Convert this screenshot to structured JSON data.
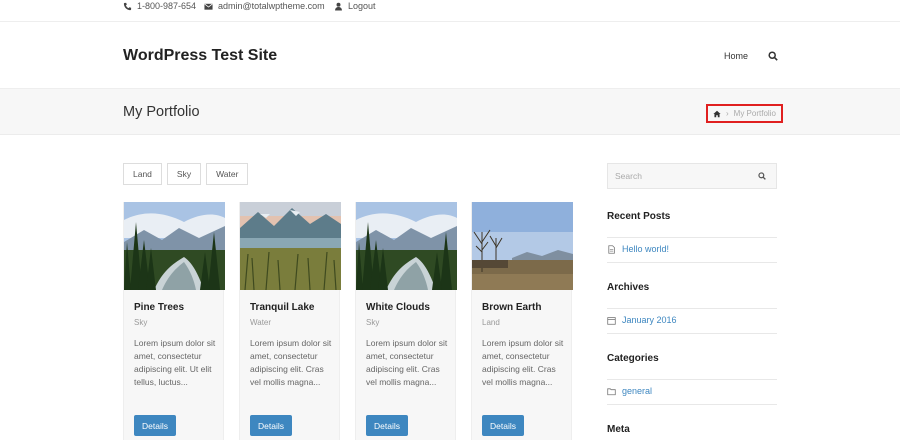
{
  "topbar": {
    "phone": "1-800-987-654",
    "email": "admin@totalwptheme.com",
    "logout": "Logout"
  },
  "header": {
    "site_title": "WordPress Test Site",
    "nav_home": "Home"
  },
  "page_header": {
    "title": "My Portfolio",
    "breadcrumb_separator": "›",
    "breadcrumb_current": "My Portfolio"
  },
  "filters": [
    "Land",
    "Sky",
    "Water"
  ],
  "portfolio": [
    {
      "title": "Pine Trees",
      "category": "Sky",
      "excerpt": "Lorem ipsum dolor sit amet, consectetur adipiscing elit. Ut elit tellus, luctus...",
      "button": "Details",
      "image": "pine-river-icon"
    },
    {
      "title": "Tranquil Lake",
      "category": "Water",
      "excerpt": "Lorem ipsum dolor sit amet, consectetur adipiscing elit. Cras vel mollis magna...",
      "button": "Details",
      "image": "mountain-lake-icon"
    },
    {
      "title": "White Clouds",
      "category": "Sky",
      "excerpt": "Lorem ipsum dolor sit amet, consectetur adipiscing elit. Cras vel mollis magna...",
      "button": "Details",
      "image": "pine-river-icon"
    },
    {
      "title": "Brown Earth",
      "category": "Land",
      "excerpt": "Lorem ipsum dolor sit amet, consectetur adipiscing elit. Cras vel mollis magna...",
      "button": "Details",
      "image": "field-trees-icon"
    }
  ],
  "sidebar": {
    "search_placeholder": "Search",
    "recent_posts": {
      "title": "Recent Posts",
      "items": [
        "Hello world!"
      ]
    },
    "archives": {
      "title": "Archives",
      "items": [
        "January 2016"
      ]
    },
    "categories": {
      "title": "Categories",
      "items": [
        "general"
      ]
    },
    "meta": {
      "title": "Meta"
    }
  },
  "colors": {
    "accent": "#3e87c0",
    "breadcrumb_highlight": "#e02020",
    "band_background": "#f7f7f7"
  }
}
